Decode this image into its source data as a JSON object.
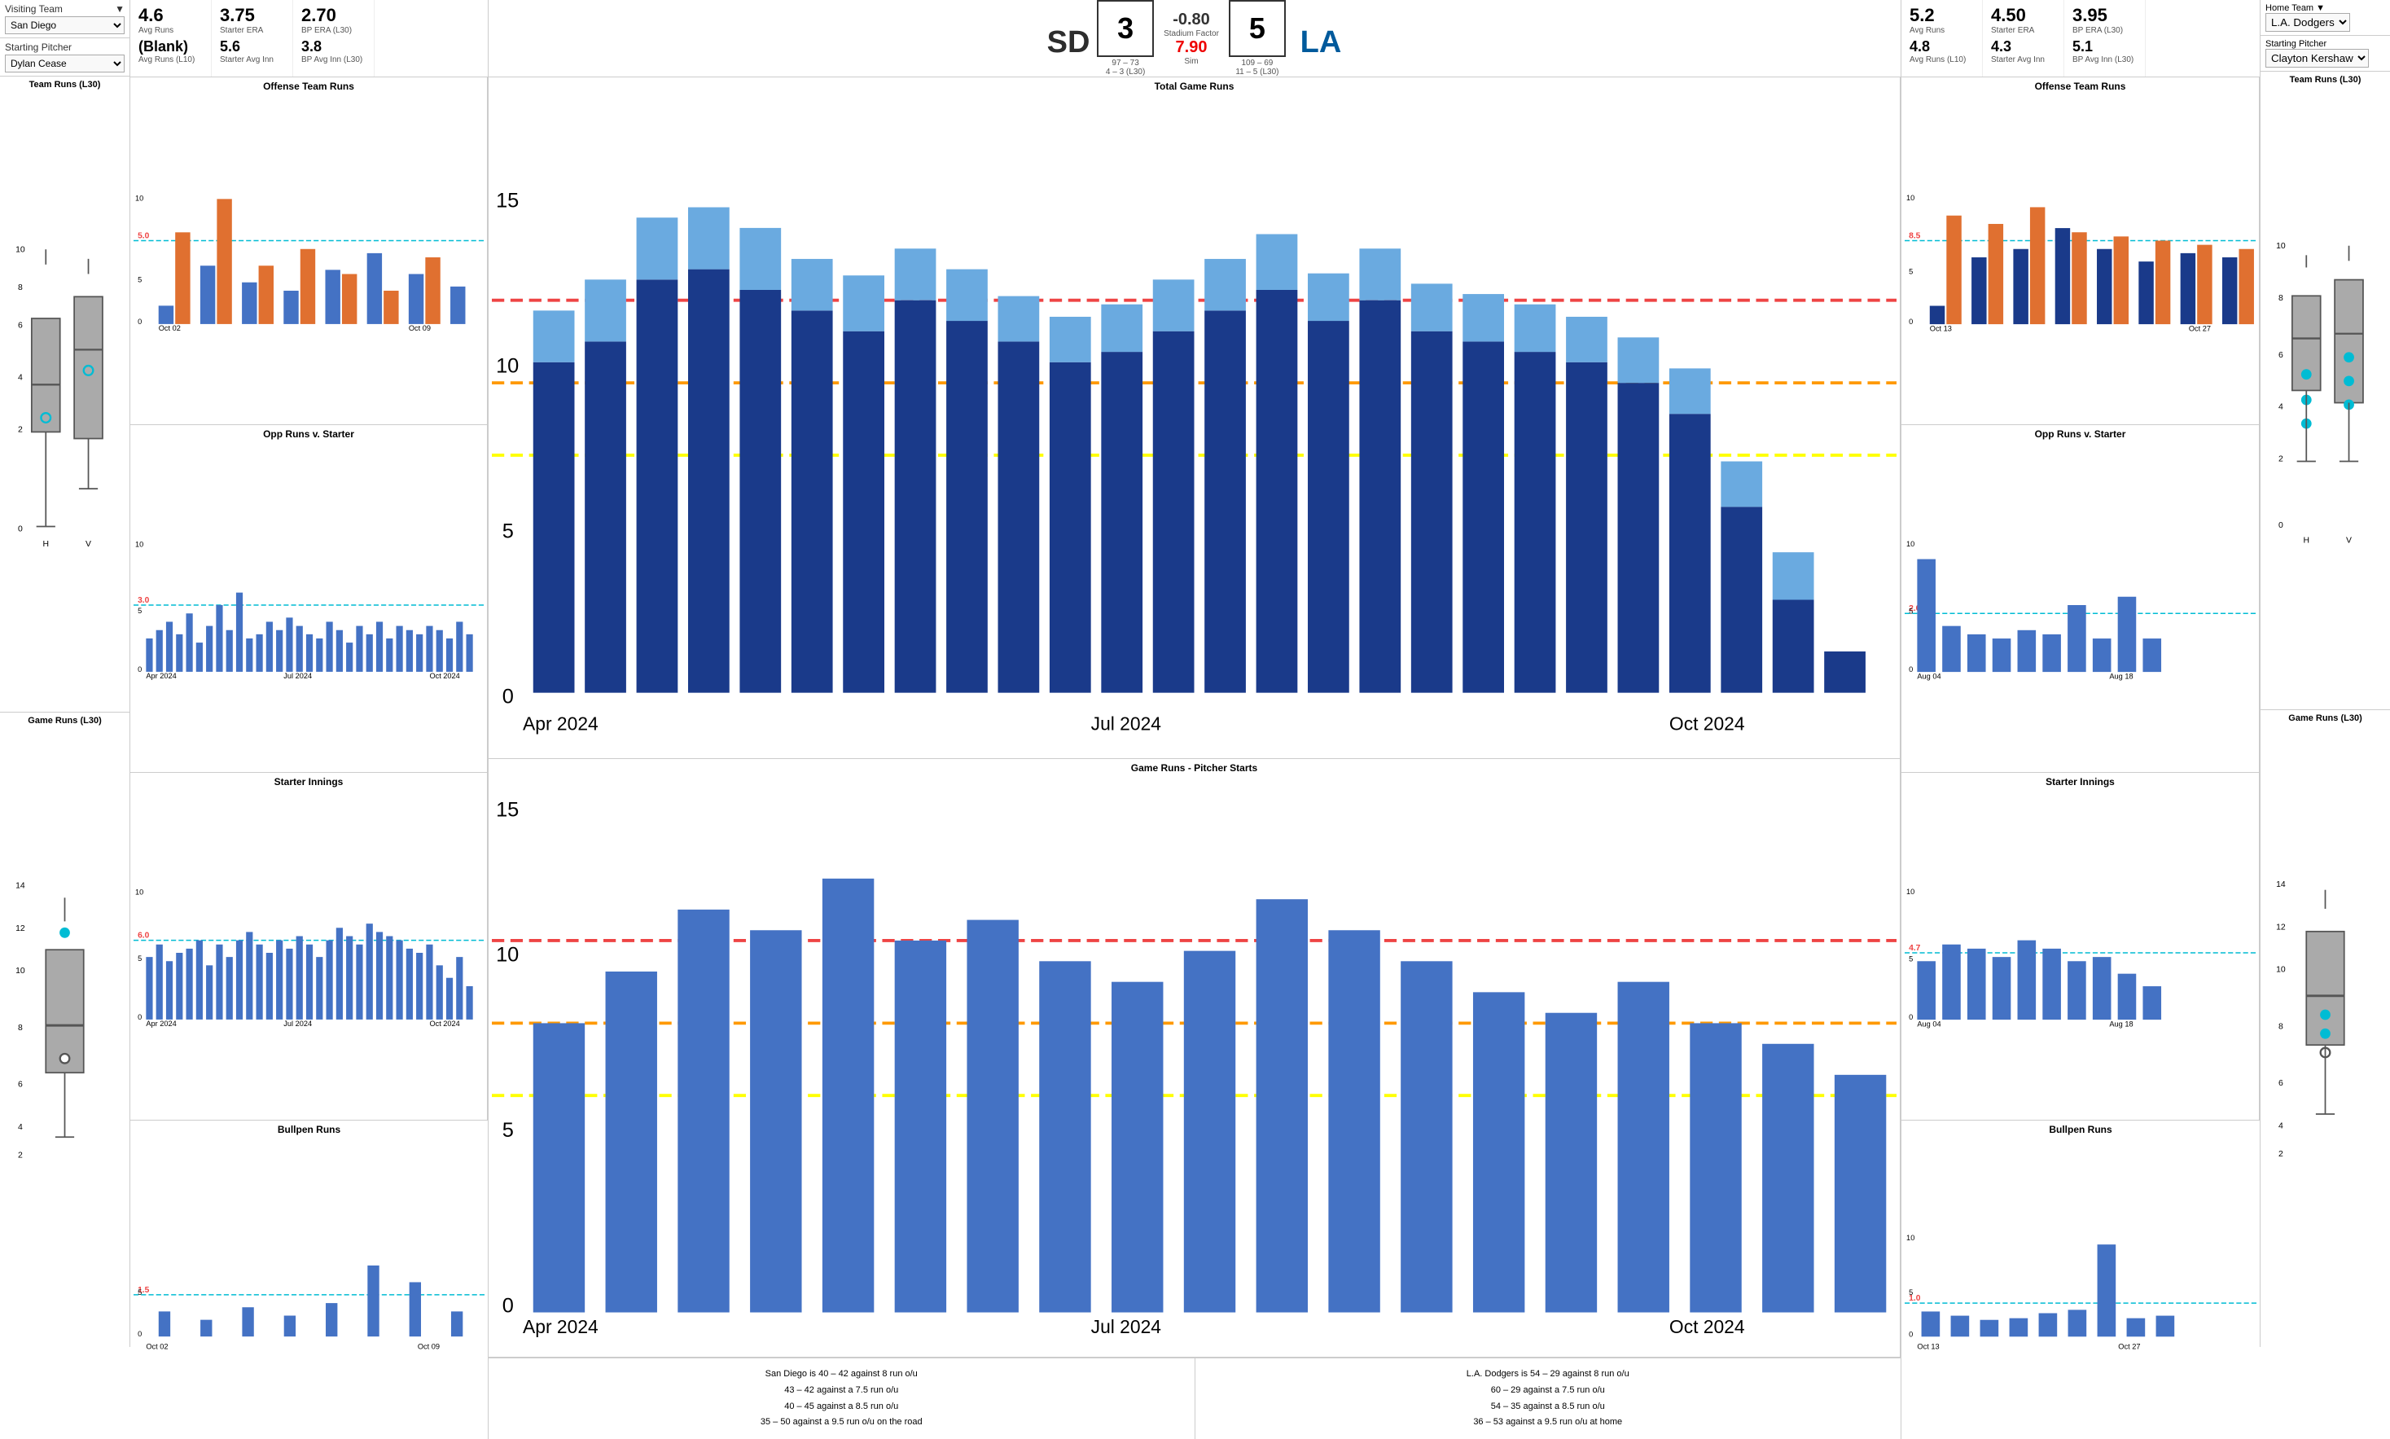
{
  "visiting": {
    "label": "Visiting Team",
    "team": "San Diego",
    "pitcher_label": "Starting Pitcher",
    "pitcher": "Dylan Cease",
    "avg_runs": "4.6",
    "avg_runs_label": "Avg Runs",
    "starter_era": "3.75",
    "starter_era_label": "Starter ERA",
    "bp_era": "2.70",
    "bp_era_label": "BP ERA (L30)",
    "avg_runs_l10": "(Blank)",
    "avg_runs_l10_label": "Avg Runs (L10)",
    "starter_avg_inn": "5.6",
    "starter_avg_inn_label": "Starter Avg Inn",
    "bp_avg_inn": "3.8",
    "bp_avg_inn_label": "BP Avg Inn (L30)",
    "score": "3",
    "record": "97 – 73",
    "record_l30": "4 – 3 (L30)",
    "team_runs_l30_title": "Team Runs (L30)",
    "game_runs_l30_title": "Game Runs (L30)"
  },
  "home": {
    "label": "Home Team",
    "team": "L.A. Dodgers",
    "pitcher_label": "Starting Pitcher",
    "pitcher": "Clayton Kershaw",
    "avg_runs": "5.2",
    "avg_runs_label": "Avg Runs",
    "starter_era": "4.50",
    "starter_era_label": "Starter ERA",
    "bp_era": "3.95",
    "bp_era_label": "BP ERA (L30)",
    "avg_runs_l10": "4.8",
    "avg_runs_l10_label": "Avg Runs (L10)",
    "starter_avg_inn": "4.3",
    "starter_avg_inn_label": "Starter Avg Inn",
    "bp_avg_inn": "5.1",
    "bp_avg_inn_label": "BP Avg Inn (L30)",
    "score": "5",
    "record": "109 – 69",
    "record_l30": "11 – 5 (L30)",
    "team_runs_l30_title": "Team Runs (L30)",
    "game_runs_l30_title": "Game Runs (L30)"
  },
  "stadium": {
    "factor_label": "Stadium Factor",
    "factor_value": "-0.80",
    "sim_label": "Sim",
    "sim_value": "7.90"
  },
  "charts": {
    "offense_team_runs_title": "Offense Team Runs",
    "opp_runs_starter_title": "Opp Runs v. Starter",
    "starter_innings_title": "Starter Innings",
    "bullpen_runs_title": "Bullpen Runs",
    "total_game_runs_title": "Total Game Runs",
    "game_runs_pitcher_title": "Game Runs - Pitcher Starts"
  },
  "notes": {
    "visiting": "San Diego is 40 – 42 against 8 run o/u\n43 – 42 against a 7.5 run o/u\n40 – 45 against a 8.5 run o/u\n35 – 50 against a 9.5 run o/u on the road",
    "home": "L.A. Dodgers is 54 – 29 against 8 run o/u\n60 – 29 against a 7.5 run o/u\n54 – 35 against a 8.5 run o/u\n36 – 53 against a 9.5 run o/u at home"
  }
}
